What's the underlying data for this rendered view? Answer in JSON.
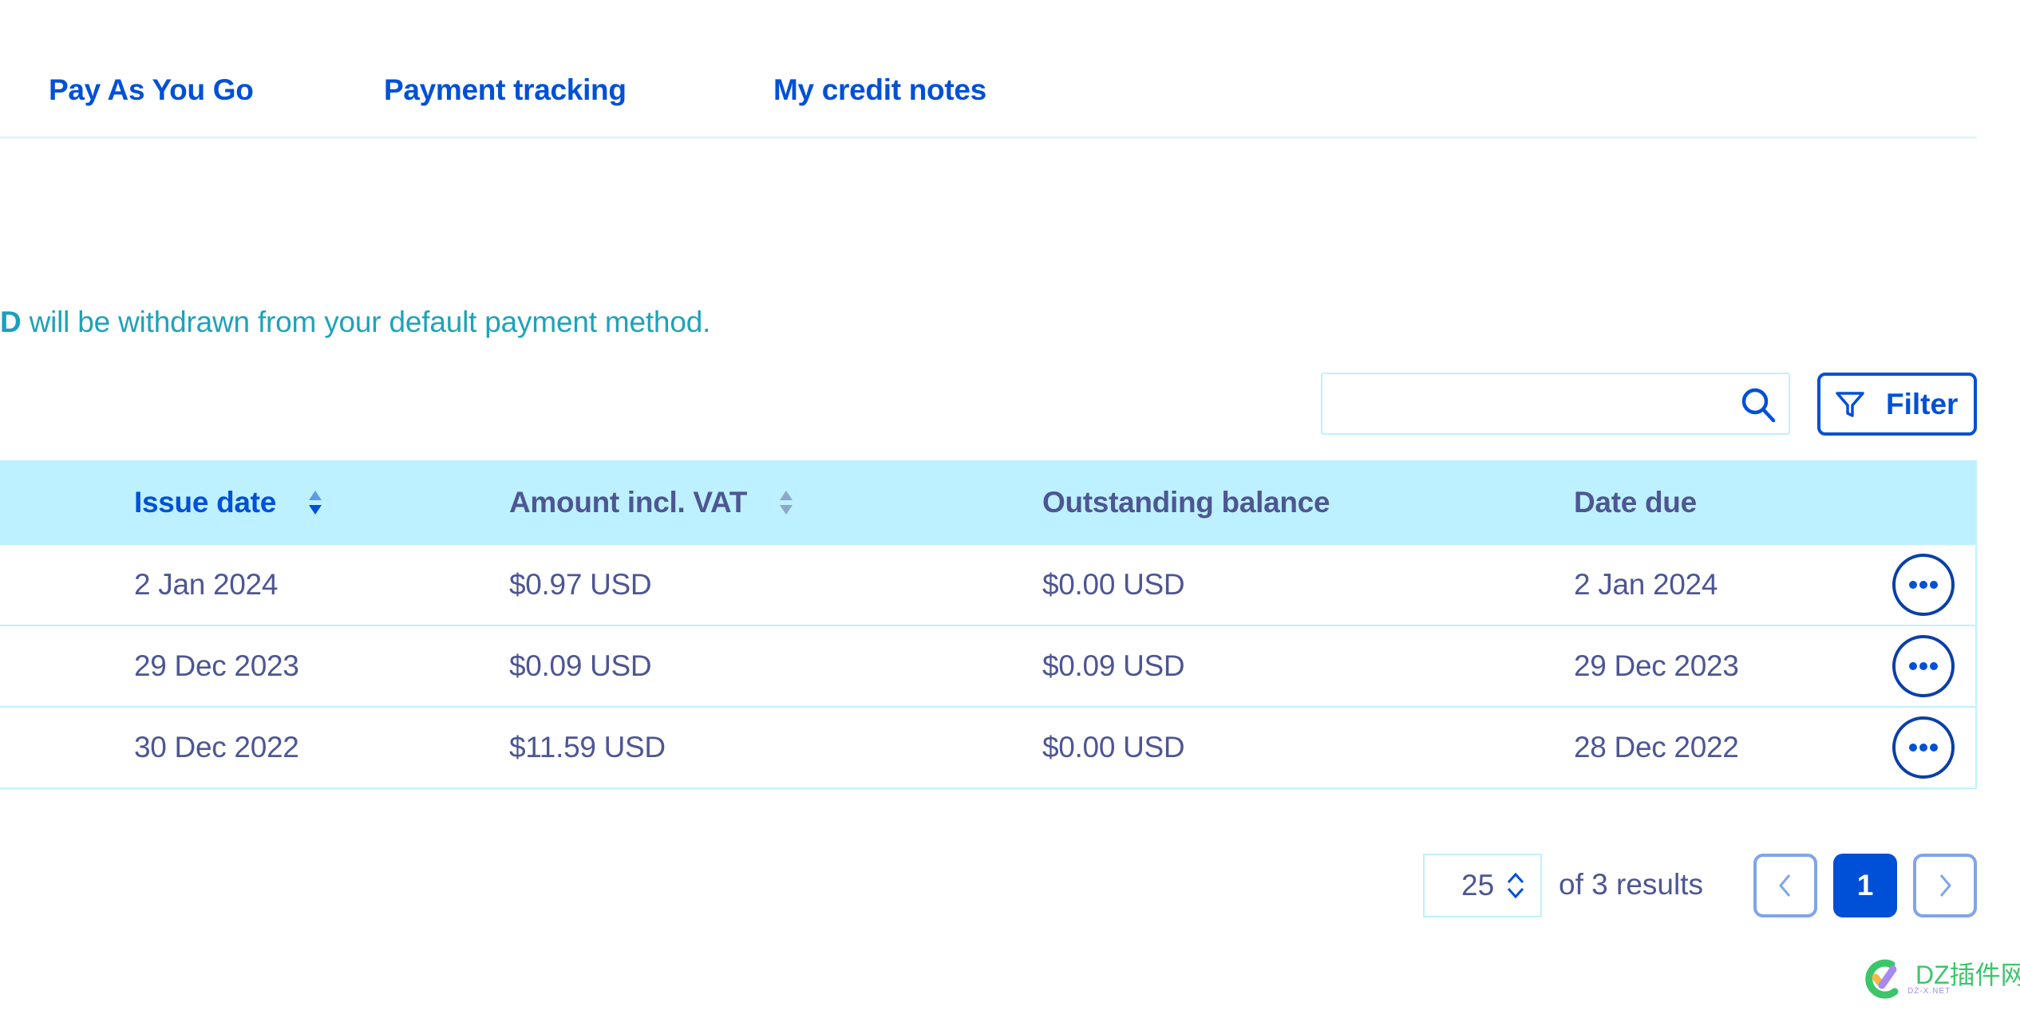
{
  "tabs": [
    {
      "label": "Pay As You Go"
    },
    {
      "label": "Payment tracking"
    },
    {
      "label": "My credit notes"
    }
  ],
  "info": {
    "bold_prefix": "D",
    "text": " will be withdrawn from your default payment method."
  },
  "search": {
    "value": "",
    "placeholder": "",
    "icon": "search-icon"
  },
  "filter": {
    "label": "Filter",
    "icon": "funnel-icon"
  },
  "table": {
    "columns": [
      {
        "label": "Issue date",
        "sortable": true,
        "active": true
      },
      {
        "label": "Amount incl. VAT",
        "sortable": true,
        "active": false
      },
      {
        "label": "Outstanding balance",
        "sortable": false
      },
      {
        "label": "Date due",
        "sortable": false
      }
    ],
    "rows": [
      {
        "issue_date": "2 Jan 2024",
        "amount": "$0.97 USD",
        "outstanding": "$0.00 USD",
        "date_due": "2 Jan 2024"
      },
      {
        "issue_date": "29 Dec 2023",
        "amount": "$0.09 USD",
        "outstanding": "$0.09 USD",
        "date_due": "29 Dec 2023"
      },
      {
        "issue_date": "30 Dec 2022",
        "amount": "$11.59 USD",
        "outstanding": "$0.00 USD",
        "date_due": "28 Dec 2022"
      }
    ],
    "row_action_icon": "more-horizontal-icon"
  },
  "pagination": {
    "per_page": "25",
    "results_label": "of 3 results",
    "current_page": "1",
    "prev_icon": "chevron-left-icon",
    "next_icon": "chevron-right-icon"
  },
  "watermark": {
    "text": "DZ插件网",
    "sub": "DZ-X.NET"
  },
  "colors": {
    "accent": "#0050d7",
    "header_bg": "#bef1ff",
    "text": "#4d5693",
    "info": "#1fa2b8"
  }
}
